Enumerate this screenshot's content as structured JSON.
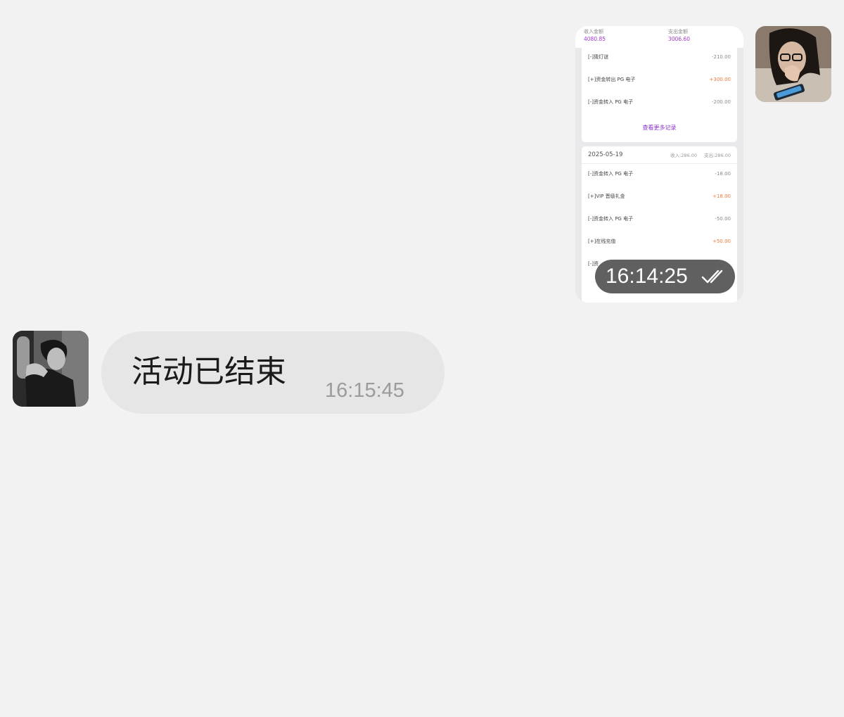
{
  "messages": {
    "outgoing": {
      "timestamp": "16:14:25",
      "status_icon": "double-check-icon",
      "screenshot": {
        "header": {
          "income_label": "收入金额",
          "income_value": "4080.85",
          "expense_label": "支出金额",
          "expense_value": "3006.60"
        },
        "card1": {
          "rows": [
            {
              "name": "[-]猜灯谜",
              "amount": "-210.00",
              "type": "negative"
            },
            {
              "name": "[+]资金转出 PG 电子",
              "amount": "+300.00",
              "type": "positive"
            },
            {
              "name": "[-]资金转入 PG 电子",
              "amount": "-200.00",
              "type": "negative"
            }
          ],
          "more": "查看更多记录"
        },
        "card2": {
          "date": "2025-05-19",
          "income": "收入:286.00",
          "expense": "支出:286.00",
          "rows": [
            {
              "name": "[-]资金转入 PG 电子",
              "amount": "-18.00",
              "type": "negative"
            },
            {
              "name": "[+]VIP 晋级礼金",
              "amount": "+18.00",
              "type": "positive"
            },
            {
              "name": "[-]资金转入 PG 电子",
              "amount": "-50.00",
              "type": "negative"
            },
            {
              "name": "[+]在线充值",
              "amount": "+50.00",
              "type": "positive"
            },
            {
              "name": "[-]资",
              "amount": "",
              "type": "negative"
            }
          ]
        }
      }
    },
    "incoming": {
      "text": "活动已结束",
      "timestamp": "16:15:45"
    }
  },
  "colors": {
    "background": "#f2f2f2",
    "incoming_bubble": "#e6e6e6",
    "accent_purple": "#8d2fd0",
    "positive_amount": "#ef7a3c"
  }
}
